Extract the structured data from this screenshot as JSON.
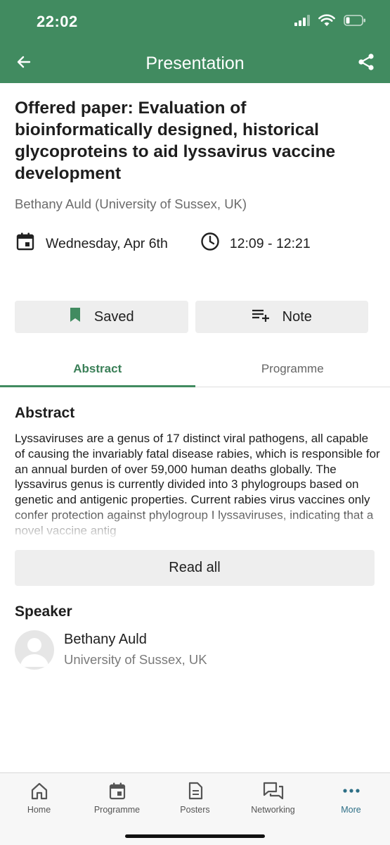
{
  "status_bar": {
    "time": "22:02"
  },
  "header": {
    "title": "Presentation"
  },
  "presentation": {
    "title": "Offered paper: Evaluation of bioinformatically designed, historical glycoproteins to aid lyssavirus vaccine development",
    "authors": "Bethany Auld (University of Sussex, UK)",
    "date": "Wednesday, Apr 6th",
    "time": "12:09 - 12:21"
  },
  "actions": {
    "saved_label": "Saved",
    "note_label": "Note"
  },
  "tabs": [
    {
      "label": "Abstract",
      "active": true
    },
    {
      "label": "Programme",
      "active": false
    }
  ],
  "abstract": {
    "heading": "Abstract",
    "text": "Lyssaviruses are a genus of 17 distinct viral pathogens, all capable of causing the invariably fatal disease rabies, which is responsible for an annual burden of over 59,000 human deaths globally. The lyssavirus genus is currently divided into 3 phylogroups based on genetic and antigenic properties. Current rabies virus vaccines only confer protection against phylogroup I lyssaviruses, indicating that a novel vaccine antig",
    "read_all_label": "Read all"
  },
  "speaker": {
    "heading": "Speaker",
    "name": "Bethany Auld",
    "affiliation": "University of Sussex, UK"
  },
  "bottom_nav": [
    {
      "label": "Home",
      "icon": "home-icon"
    },
    {
      "label": "Programme",
      "icon": "calendar-icon"
    },
    {
      "label": "Posters",
      "icon": "document-icon"
    },
    {
      "label": "Networking",
      "icon": "chat-icon"
    },
    {
      "label": "More",
      "icon": "more-icon",
      "active": true
    }
  ],
  "colors": {
    "brand_green": "#418b60",
    "tab_active": "#3a7f57",
    "nav_active": "#2d6f86",
    "button_bg": "#eeeeee"
  }
}
